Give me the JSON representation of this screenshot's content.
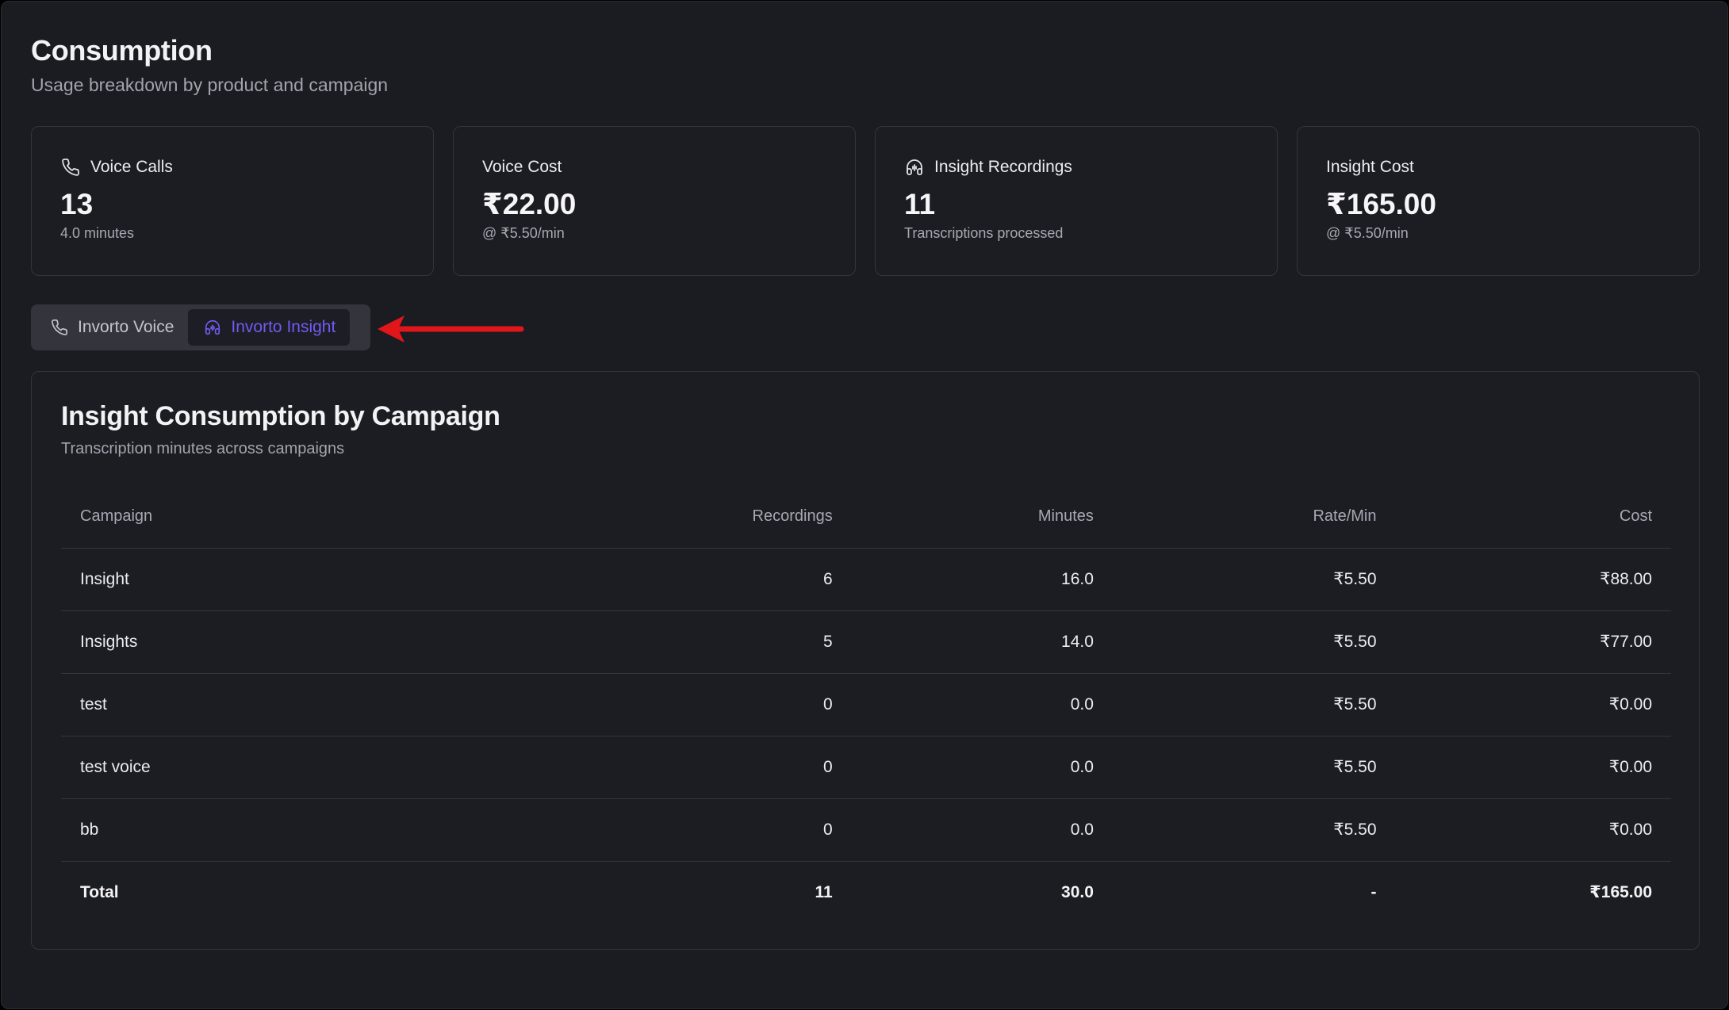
{
  "header": {
    "title": "Consumption",
    "subtitle": "Usage breakdown by product and campaign"
  },
  "stats": [
    {
      "label": "Voice Calls",
      "icon": "phone-icon",
      "value": "13",
      "sub": "4.0 minutes"
    },
    {
      "label": "Voice Cost",
      "icon": "",
      "value": "₹22.00",
      "sub": "@ ₹5.50/min"
    },
    {
      "label": "Insight Recordings",
      "icon": "headphones-icon",
      "value": "11",
      "sub": "Transcriptions processed"
    },
    {
      "label": "Insight Cost",
      "icon": "",
      "value": "₹165.00",
      "sub": "@ ₹5.50/min"
    }
  ],
  "tabs": [
    {
      "label": "Invorto Voice",
      "icon": "phone-icon",
      "active": false
    },
    {
      "label": "Invorto Insight",
      "icon": "headphones-icon",
      "active": true
    }
  ],
  "colors": {
    "accent": "#6e5cf0",
    "annotation": "#e0161b"
  },
  "table": {
    "title": "Insight Consumption by Campaign",
    "subtitle": "Transcription minutes across campaigns",
    "columns": [
      "Campaign",
      "Recordings",
      "Minutes",
      "Rate/Min",
      "Cost"
    ],
    "rows": [
      {
        "campaign": "Insight",
        "recordings": "6",
        "minutes": "16.0",
        "rate": "₹5.50",
        "cost": "₹88.00"
      },
      {
        "campaign": "Insights",
        "recordings": "5",
        "minutes": "14.0",
        "rate": "₹5.50",
        "cost": "₹77.00"
      },
      {
        "campaign": "test",
        "recordings": "0",
        "minutes": "0.0",
        "rate": "₹5.50",
        "cost": "₹0.00"
      },
      {
        "campaign": "test voice",
        "recordings": "0",
        "minutes": "0.0",
        "rate": "₹5.50",
        "cost": "₹0.00"
      },
      {
        "campaign": "bb",
        "recordings": "0",
        "minutes": "0.0",
        "rate": "₹5.50",
        "cost": "₹0.00"
      }
    ],
    "total": {
      "campaign": "Total",
      "recordings": "11",
      "minutes": "30.0",
      "rate": "-",
      "cost": "₹165.00"
    }
  }
}
